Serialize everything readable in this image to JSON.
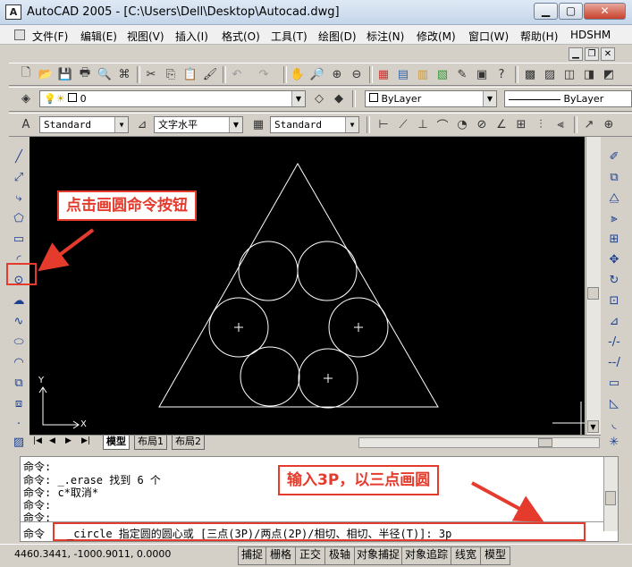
{
  "window": {
    "title": "AutoCAD 2005 - [C:\\Users\\Dell\\Desktop\\Autocad.dwg]",
    "app_icon": "A",
    "minimize_icon": "minimize-icon",
    "maximize_icon": "maximize-icon",
    "close_icon": "close-icon"
  },
  "menu": [
    "文件(F)",
    "编辑(E)",
    "视图(V)",
    "插入(I)",
    "格式(O)",
    "工具(T)",
    "绘图(D)",
    "标注(N)",
    "修改(M)",
    "窗口(W)",
    "帮助(H)",
    "HDSHM"
  ],
  "layer_toolbar": {
    "layer_value": "0",
    "color_value": "ByLayer",
    "linetype_value": "ByLayer"
  },
  "styles_toolbar": {
    "text_style": "Standard",
    "text_style_2": "文字水平",
    "dim_style": "Standard"
  },
  "tabs": [
    "模型",
    "布局1",
    "布局2"
  ],
  "ucs": {
    "x": "X",
    "y": "Y"
  },
  "command_lines": [
    "命令:",
    "命令:  _.erase 找到 6 个",
    "命令:  c*取消*",
    "命令:",
    "命令:"
  ],
  "command_prompt": {
    "label": "命令",
    "text": "_circle 指定圆的圆心或 [三点(3P)/两点(2P)/相切、相切、半径(T)]: 3p"
  },
  "status": {
    "coords": "4460.3441, -1000.9011, 0.0000",
    "buttons": [
      "捕捉",
      "栅格",
      "正交",
      "极轴",
      "对象捕捉",
      "对象追踪",
      "线宽",
      "模型"
    ]
  },
  "annotations": {
    "callout_1": "点击画圆命令按钮",
    "callout_2": "输入3P，以三点画圆"
  },
  "colors": {
    "accent": "#e53b2c",
    "canvas": "#000000",
    "geometry": "#ffffff"
  }
}
